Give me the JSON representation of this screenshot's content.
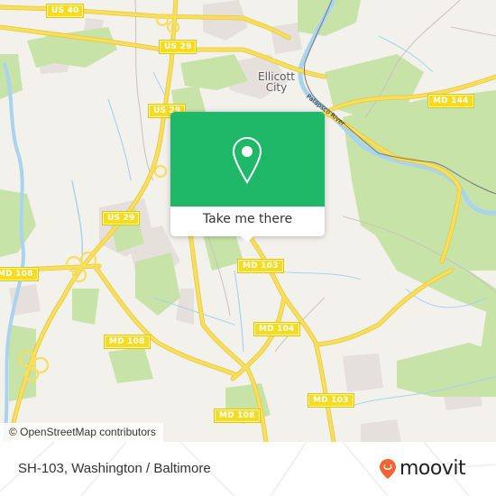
{
  "map": {
    "attribution": "© OpenStreetMap contributors",
    "place_labels": [
      {
        "id": "ellicott-city",
        "line1": "Ellicott",
        "line2": "City"
      }
    ],
    "river_label": "Patapsco River",
    "road_shields": [
      {
        "id": "us40",
        "label": "US 40"
      },
      {
        "id": "us29-a",
        "label": "US 29"
      },
      {
        "id": "us29-b",
        "label": "US 29"
      },
      {
        "id": "us29-c",
        "label": "US 29"
      },
      {
        "id": "md144",
        "label": "MD 144"
      },
      {
        "id": "md108-a",
        "label": "MD 108"
      },
      {
        "id": "md108-b",
        "label": "MD 108"
      },
      {
        "id": "md108-c",
        "label": "MD 108"
      },
      {
        "id": "md103-a",
        "label": "MD 103"
      },
      {
        "id": "md103-b",
        "label": "MD 103"
      },
      {
        "id": "md104",
        "label": "MD 104"
      }
    ],
    "colors": {
      "background": "#f2f1ec",
      "park": "#c8e3a8",
      "water": "#a9d3ee",
      "highway": "#f7df5c",
      "residential": "#e6e0dc"
    }
  },
  "popup": {
    "icon": "map-pin-icon",
    "button_label": "Take me there",
    "accent": "#1fb868"
  },
  "footer": {
    "title": "SH-103, Washington / Baltimore",
    "brand": "moovit",
    "brand_icon": "moovit-pin-icon",
    "brand_color": "#f26532"
  }
}
